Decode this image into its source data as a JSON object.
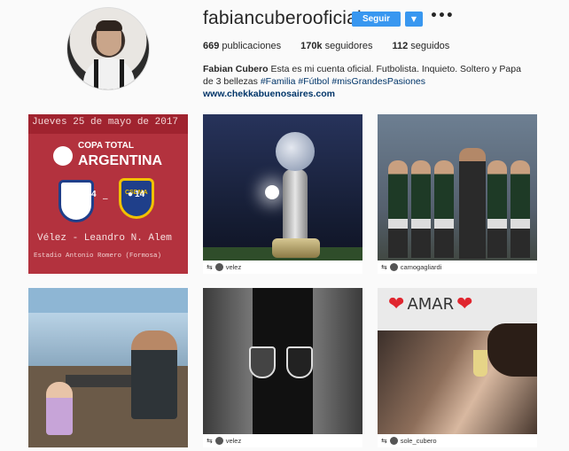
{
  "profile": {
    "username": "fabiancuberooficial",
    "follow_label": "Seguir",
    "dropdown_icon": "▼",
    "more_icon": "•••",
    "stats": {
      "posts_count": "669",
      "posts_label": "publicaciones",
      "followers_count": "170k",
      "followers_label": "seguidores",
      "following_count": "112",
      "following_label": "seguidos"
    },
    "bio": {
      "name": "Fabian Cubero",
      "text1": "Esta es mi cuenta oficial. Futbolista. Inquieto. Soltero y Papa de 3 bellezas",
      "tag1": "#Familia",
      "tag2": "#Fútbol",
      "tag3": "#misGrandesPasiones",
      "link": "www.chekkabuenosaires.com"
    }
  },
  "posts": [
    {
      "date_text": "Jueves 25 de mayo de 2017",
      "copa_text": "COPA TOTAL",
      "arg_text": "ARGENTINA",
      "likes": "544",
      "comments": "14",
      "match_text": "Vélez - Leandro N. Alem",
      "venue_text": "Estadio Antonio Romero (Formosa)",
      "shield_text": "CSDMA"
    },
    {
      "tag_user": "velez"
    },
    {
      "tag_user": "camogagliardi"
    },
    {},
    {
      "tag_user": "velez"
    },
    {
      "amar_text": "AMAR",
      "heart": "❤",
      "tag_user": "sole_cubero"
    }
  ],
  "colors": {
    "accent": "#3897f0",
    "link": "#003569"
  }
}
